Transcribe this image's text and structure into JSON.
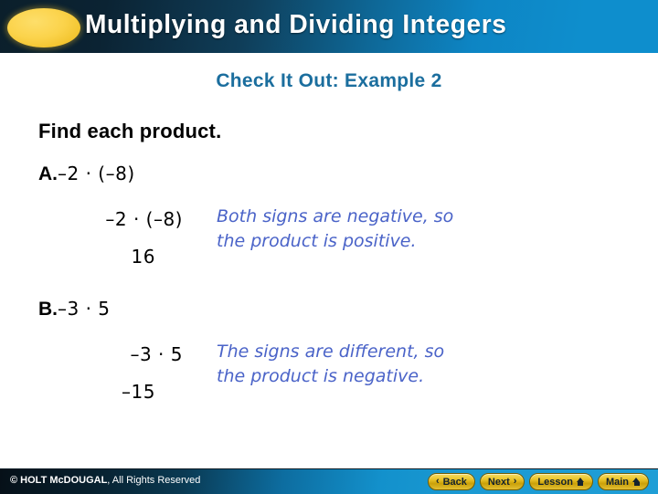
{
  "header": {
    "title": "Multiplying and Dividing Integers",
    "oval_color": "#f2c32c",
    "accent_color": "#0e8ecd"
  },
  "slide": {
    "subtitle": "Check It Out: Example 2",
    "subtitle_color": "#1b6e9e",
    "prompt": "Find each product.",
    "note_color": "#4a63c8",
    "problems": [
      {
        "letter": "A.",
        "expression": "–2 · (–8)",
        "work_line_1": "–2 · (–8)",
        "work_line_2": "16",
        "note_line_1": "Both signs are negative, so",
        "note_line_2": "the product is positive."
      },
      {
        "letter": "B.",
        "expression": "–3 · 5",
        "work_line_1": "–3 · 5",
        "work_line_2": "–15",
        "note_line_1": "The signs are different, so",
        "note_line_2": "the product is negative."
      }
    ]
  },
  "footer": {
    "copyright_bold": "© HOLT McDOUGAL",
    "copyright_rest": ", All Rights Reserved",
    "buttons": [
      {
        "label": "Back",
        "icon": "chevron-left-icon",
        "glyph": "‹"
      },
      {
        "label": "Next",
        "icon": "chevron-right-icon",
        "glyph": "›"
      },
      {
        "label": "Lesson",
        "icon": "home-icon",
        "glyph": ""
      },
      {
        "label": "Main",
        "icon": "home-icon",
        "glyph": ""
      }
    ]
  }
}
